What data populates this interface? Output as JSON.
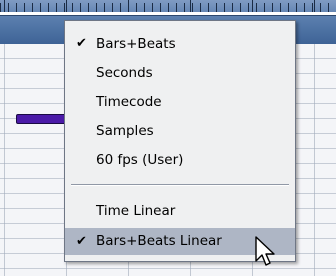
{
  "menu": {
    "items": [
      {
        "label": "Bars+Beats",
        "checked": true
      },
      {
        "label": "Seconds",
        "checked": false
      },
      {
        "label": "Timecode",
        "checked": false
      },
      {
        "label": "Samples",
        "checked": false
      },
      {
        "label": "60 fps (User)",
        "checked": false
      },
      {
        "label": "Time Linear",
        "checked": false
      },
      {
        "label": "Bars+Beats Linear",
        "checked": true
      }
    ],
    "check_glyph": "✔"
  },
  "colors": {
    "ruler": "#4a6fa5",
    "part": "#4b1aa8",
    "menu_bg": "#eff0f1",
    "hover": "#aeb6c5"
  },
  "icons": {
    "cursor": "arrow-pointer-icon",
    "check": "checkmark-icon"
  }
}
